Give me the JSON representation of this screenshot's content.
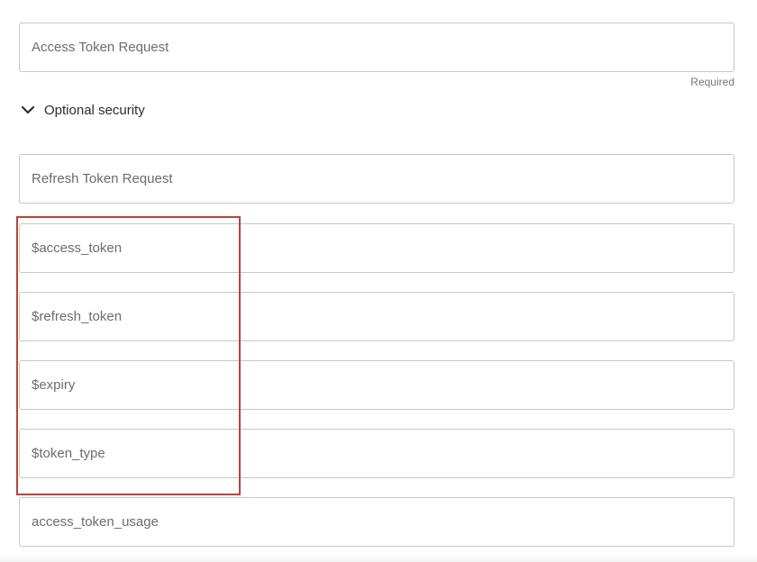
{
  "fields": {
    "access_token_request": {
      "value": "Access Token Request"
    },
    "refresh_token_request": {
      "value": "Refresh Token Request"
    },
    "access_token_var": {
      "value": "$access_token"
    },
    "refresh_token_var": {
      "value": "$refresh_token"
    },
    "expiry_var": {
      "value": "$expiry"
    },
    "token_type_var": {
      "value": "$token_type"
    },
    "access_token_usage": {
      "value": "access_token_usage"
    }
  },
  "required_label": "Required",
  "optional_section": {
    "label": "Optional security",
    "icon": "chevron-down-icon",
    "expanded": true
  },
  "colors": {
    "border": "#c9c7c4",
    "text": "#76736f",
    "highlight": "#b5453a"
  }
}
